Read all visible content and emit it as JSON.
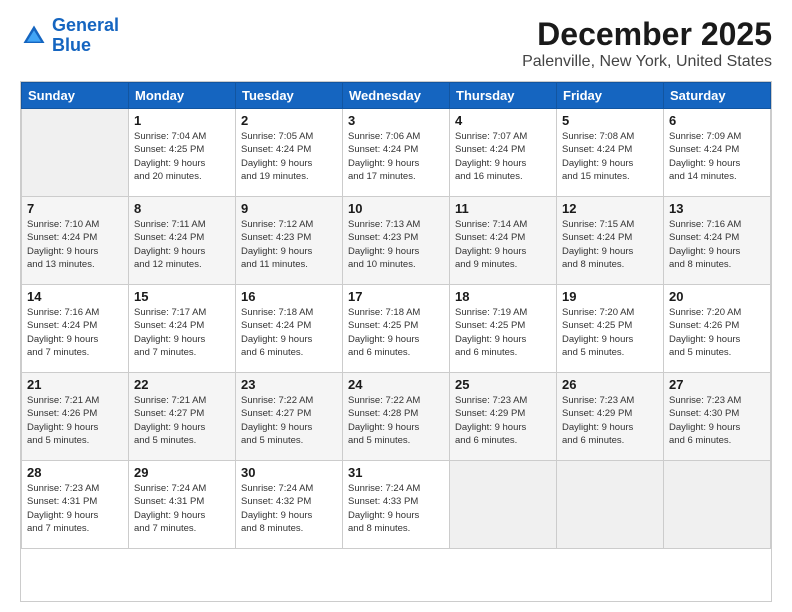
{
  "header": {
    "logo_line1": "General",
    "logo_line2": "Blue",
    "title": "December 2025",
    "subtitle": "Palenville, New York, United States"
  },
  "days_of_week": [
    "Sunday",
    "Monday",
    "Tuesday",
    "Wednesday",
    "Thursday",
    "Friday",
    "Saturday"
  ],
  "weeks": [
    [
      {
        "day": "",
        "info": ""
      },
      {
        "day": "1",
        "info": "Sunrise: 7:04 AM\nSunset: 4:25 PM\nDaylight: 9 hours\nand 20 minutes."
      },
      {
        "day": "2",
        "info": "Sunrise: 7:05 AM\nSunset: 4:24 PM\nDaylight: 9 hours\nand 19 minutes."
      },
      {
        "day": "3",
        "info": "Sunrise: 7:06 AM\nSunset: 4:24 PM\nDaylight: 9 hours\nand 17 minutes."
      },
      {
        "day": "4",
        "info": "Sunrise: 7:07 AM\nSunset: 4:24 PM\nDaylight: 9 hours\nand 16 minutes."
      },
      {
        "day": "5",
        "info": "Sunrise: 7:08 AM\nSunset: 4:24 PM\nDaylight: 9 hours\nand 15 minutes."
      },
      {
        "day": "6",
        "info": "Sunrise: 7:09 AM\nSunset: 4:24 PM\nDaylight: 9 hours\nand 14 minutes."
      }
    ],
    [
      {
        "day": "7",
        "info": "Sunrise: 7:10 AM\nSunset: 4:24 PM\nDaylight: 9 hours\nand 13 minutes."
      },
      {
        "day": "8",
        "info": "Sunrise: 7:11 AM\nSunset: 4:24 PM\nDaylight: 9 hours\nand 12 minutes."
      },
      {
        "day": "9",
        "info": "Sunrise: 7:12 AM\nSunset: 4:23 PM\nDaylight: 9 hours\nand 11 minutes."
      },
      {
        "day": "10",
        "info": "Sunrise: 7:13 AM\nSunset: 4:23 PM\nDaylight: 9 hours\nand 10 minutes."
      },
      {
        "day": "11",
        "info": "Sunrise: 7:14 AM\nSunset: 4:24 PM\nDaylight: 9 hours\nand 9 minutes."
      },
      {
        "day": "12",
        "info": "Sunrise: 7:15 AM\nSunset: 4:24 PM\nDaylight: 9 hours\nand 8 minutes."
      },
      {
        "day": "13",
        "info": "Sunrise: 7:16 AM\nSunset: 4:24 PM\nDaylight: 9 hours\nand 8 minutes."
      }
    ],
    [
      {
        "day": "14",
        "info": "Sunrise: 7:16 AM\nSunset: 4:24 PM\nDaylight: 9 hours\nand 7 minutes."
      },
      {
        "day": "15",
        "info": "Sunrise: 7:17 AM\nSunset: 4:24 PM\nDaylight: 9 hours\nand 7 minutes."
      },
      {
        "day": "16",
        "info": "Sunrise: 7:18 AM\nSunset: 4:24 PM\nDaylight: 9 hours\nand 6 minutes."
      },
      {
        "day": "17",
        "info": "Sunrise: 7:18 AM\nSunset: 4:25 PM\nDaylight: 9 hours\nand 6 minutes."
      },
      {
        "day": "18",
        "info": "Sunrise: 7:19 AM\nSunset: 4:25 PM\nDaylight: 9 hours\nand 6 minutes."
      },
      {
        "day": "19",
        "info": "Sunrise: 7:20 AM\nSunset: 4:25 PM\nDaylight: 9 hours\nand 5 minutes."
      },
      {
        "day": "20",
        "info": "Sunrise: 7:20 AM\nSunset: 4:26 PM\nDaylight: 9 hours\nand 5 minutes."
      }
    ],
    [
      {
        "day": "21",
        "info": "Sunrise: 7:21 AM\nSunset: 4:26 PM\nDaylight: 9 hours\nand 5 minutes."
      },
      {
        "day": "22",
        "info": "Sunrise: 7:21 AM\nSunset: 4:27 PM\nDaylight: 9 hours\nand 5 minutes."
      },
      {
        "day": "23",
        "info": "Sunrise: 7:22 AM\nSunset: 4:27 PM\nDaylight: 9 hours\nand 5 minutes."
      },
      {
        "day": "24",
        "info": "Sunrise: 7:22 AM\nSunset: 4:28 PM\nDaylight: 9 hours\nand 5 minutes."
      },
      {
        "day": "25",
        "info": "Sunrise: 7:23 AM\nSunset: 4:29 PM\nDaylight: 9 hours\nand 6 minutes."
      },
      {
        "day": "26",
        "info": "Sunrise: 7:23 AM\nSunset: 4:29 PM\nDaylight: 9 hours\nand 6 minutes."
      },
      {
        "day": "27",
        "info": "Sunrise: 7:23 AM\nSunset: 4:30 PM\nDaylight: 9 hours\nand 6 minutes."
      }
    ],
    [
      {
        "day": "28",
        "info": "Sunrise: 7:23 AM\nSunset: 4:31 PM\nDaylight: 9 hours\nand 7 minutes."
      },
      {
        "day": "29",
        "info": "Sunrise: 7:24 AM\nSunset: 4:31 PM\nDaylight: 9 hours\nand 7 minutes."
      },
      {
        "day": "30",
        "info": "Sunrise: 7:24 AM\nSunset: 4:32 PM\nDaylight: 9 hours\nand 8 minutes."
      },
      {
        "day": "31",
        "info": "Sunrise: 7:24 AM\nSunset: 4:33 PM\nDaylight: 9 hours\nand 8 minutes."
      },
      {
        "day": "",
        "info": ""
      },
      {
        "day": "",
        "info": ""
      },
      {
        "day": "",
        "info": ""
      }
    ]
  ]
}
